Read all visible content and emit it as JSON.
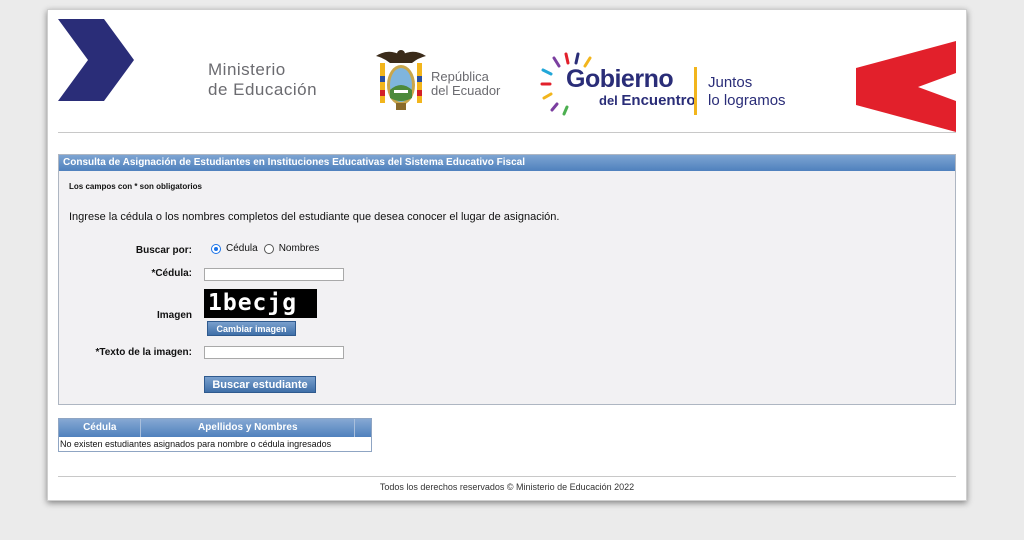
{
  "header": {
    "ministerio_line1": "Ministerio",
    "ministerio_line2": "de Educación",
    "republica_line1": "República",
    "republica_line2": "del Ecuador",
    "gobierno_title": "Gobierno",
    "gobierno_sub_prefix": "del",
    "gobierno_sub_word": "Encuentro",
    "juntos_line1": "Juntos",
    "juntos_line2": "lo logramos",
    "colors": {
      "navy": "#2a2d78",
      "red": "#e2202b",
      "yellow": "#f2b51c",
      "gray": "#6b6b70"
    }
  },
  "form": {
    "title": "Consulta de Asignación de Estudiantes en Instituciones Educativas del Sistema Educativo Fiscal",
    "required_note": "Los campos con * son obligatorios",
    "intro": "Ingrese la cédula o los nombres completos del estudiante que desea conocer el lugar de asignación.",
    "search_by_label": "Buscar por:",
    "option_cedula": "Cédula",
    "option_nombres": "Nombres",
    "selected_option": "Cédula",
    "cedula_label": "*Cédula:",
    "cedula_value": "",
    "image_label": "Imagen",
    "captcha_text": "1becjg",
    "change_image_button": "Cambiar imagen",
    "image_text_label": "*Texto de la imagen:",
    "image_text_value": "",
    "search_button": "Buscar estudiante"
  },
  "results": {
    "columns": [
      "Cédula",
      "Apellidos y Nombres"
    ],
    "empty_message": "No existen estudiantes asignados para nombre o cédula ingresados"
  },
  "footer": {
    "text": "Todos los derechos reservados © Ministerio de Educación 2022"
  }
}
